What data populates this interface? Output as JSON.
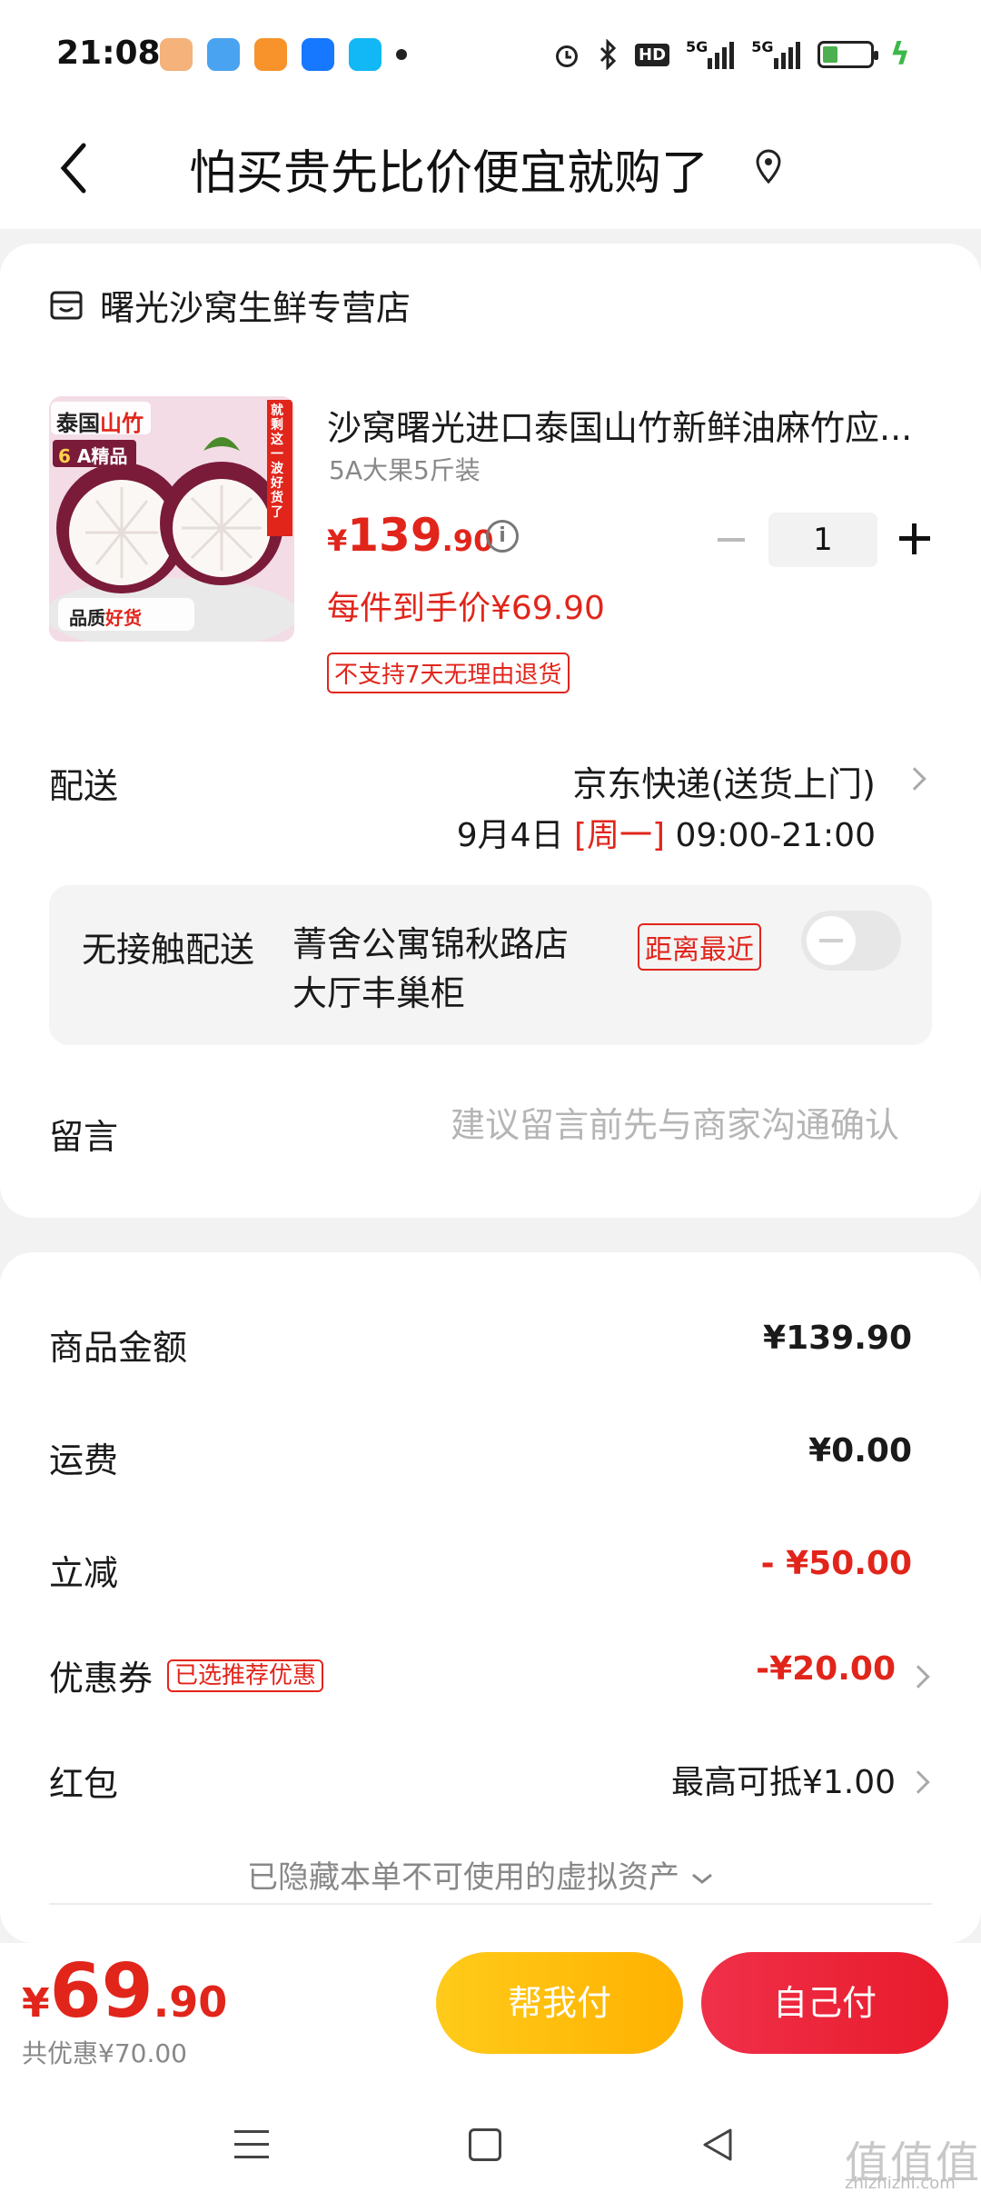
{
  "status_bar": {
    "time": "21:08",
    "icons": [
      "notification-app-icon",
      "weather-icon",
      "app-icon",
      "alipay-icon",
      "qq-icon",
      "more-dot-icon"
    ],
    "system": [
      "alarm-icon",
      "bluetooth-icon",
      "hd-icon",
      "signal-5g-icon",
      "signal-5g-icon",
      "battery-icon",
      "charging-icon"
    ],
    "hd": "HD",
    "net1": "5G",
    "net2": "5G"
  },
  "header": {
    "title": "怕买贵先比价便宜就购了",
    "back_icon": "chevron-left-icon",
    "location_icon": "location-pin-icon"
  },
  "store": {
    "name": "曙光沙窝生鲜专营店",
    "icon": "store-icon"
  },
  "product": {
    "image_labels": {
      "brand": "泰国",
      "brand_red": "山竹",
      "grade_num": "6",
      "grade": "A精品",
      "side": "就剩这一波好货了",
      "quality": "品质",
      "quality_red": "好货"
    },
    "title": "沙窝曙光进口泰国山竹新鲜油麻竹应...",
    "spec": "5A大果5斤装",
    "price_symbol": "¥",
    "price_int": "139",
    "price_dec": ".90",
    "quantity": "1",
    "per_item_price": "每件到手价¥69.90",
    "no_return_tag": "不支持7天无理由退货"
  },
  "delivery": {
    "label": "配送",
    "method": "京东快递(送货上门)",
    "date": "9月4日 ",
    "weekday": "[周一]",
    "time": " 09:00-21:00"
  },
  "contactless": {
    "label": "无接触配送",
    "address": "菁舍公寓锦秋路店大厅丰巢柜",
    "badge": "距离最近",
    "enabled": false
  },
  "message": {
    "label": "留言",
    "placeholder": "建议留言前先与商家沟通确认"
  },
  "summary": {
    "goods_label": "商品金额",
    "goods_value": "¥139.90",
    "shipping_label": "运费",
    "shipping_value": "¥0.00",
    "discount_label": "立减",
    "discount_value": "- ¥50.00",
    "coupon_label": "优惠券",
    "coupon_tag": "已选推荐优惠",
    "coupon_value": "-¥20.00",
    "redpacket_label": "红包",
    "redpacket_value": "最高可抵¥1.00",
    "hidden_assets": "已隐藏本单不可使用的虚拟资产"
  },
  "bottom": {
    "total_symbol": "¥",
    "total_int": "69",
    "total_dec": ".90",
    "total_savings": "共优惠¥70.00",
    "help_pay": "帮我付",
    "self_pay": "自己付"
  },
  "watermark": {
    "text": "值值值",
    "url": "zhizhizhi.com"
  },
  "colors": {
    "accent_red": "#e1251b",
    "help_yellow": "#ffb100",
    "self_red": "#e81b2b"
  }
}
